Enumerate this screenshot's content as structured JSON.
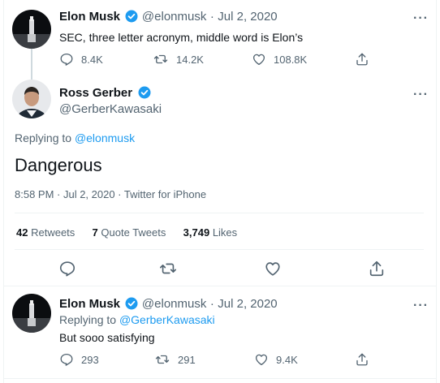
{
  "colors": {
    "link": "#1d9bf0",
    "secondary": "#536471",
    "divider": "#eff3f4",
    "verified": "#1d9bf0"
  },
  "tweet1": {
    "name": "Elon Musk",
    "handle": "@elonmusk",
    "sep": "·",
    "date": "Jul 2, 2020",
    "text": "SEC, three letter acronym, middle word is Elon’s",
    "replies": "8.4K",
    "retweets": "14.2K",
    "likes": "108.8K"
  },
  "main": {
    "name": "Ross Gerber",
    "handle": "@GerberKawasaki",
    "replying_prefix": "Replying to",
    "replying_to": "@elonmusk",
    "text": "Dangerous",
    "timestamp": "8:58 PM · Jul 2, 2020 · Twitter for iPhone",
    "stats": {
      "retweets_count": "42",
      "retweets_label": "Retweets",
      "quotes_count": "7",
      "quotes_label": "Quote Tweets",
      "likes_count": "3,749",
      "likes_label": "Likes"
    }
  },
  "reply": {
    "name": "Elon Musk",
    "handle": "@elonmusk",
    "sep": "·",
    "date": "Jul 2, 2020",
    "replying_prefix": "Replying to",
    "replying_to": "@GerberKawasaki",
    "text": "But sooo satisfying",
    "replies": "293",
    "retweets": "291",
    "likes": "9.4K"
  },
  "icons": {
    "more": "more-icon",
    "reply": "reply-icon",
    "retweet": "retweet-icon",
    "like": "heart-icon",
    "share": "share-icon",
    "verified": "verified-badge-icon"
  }
}
